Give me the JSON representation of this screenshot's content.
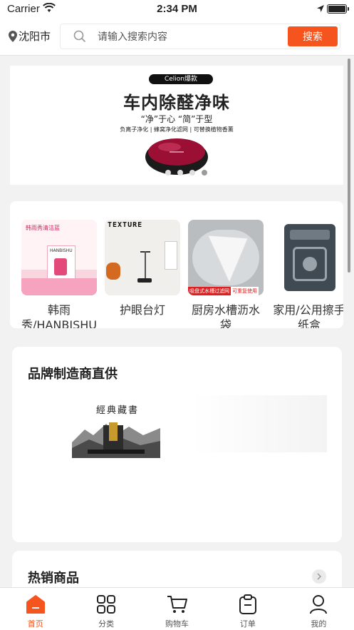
{
  "status_bar": {
    "carrier": "Carrier",
    "time": "2:34 PM"
  },
  "header": {
    "city": "沈阳市",
    "search_placeholder": "请输入搜索内容",
    "search_button": "搜索"
  },
  "banner": {
    "badge": "Celion爆款",
    "headline": "车内除醛净味",
    "slogan": "“净”于心  “简”于型",
    "features": "负离子净化 | 蜂窝净化滤网 | 可替换植物香薰",
    "slide_count": 4,
    "active_slide": 4
  },
  "categories": [
    {
      "label": "韩雨秀/HANBISHU除",
      "image_text": [
        "韩雨秀清洁蓝",
        "HANBISHU"
      ]
    },
    {
      "label": "护眼台灯",
      "image_text": [
        "TEXTURE"
      ]
    },
    {
      "label": "厨房水槽沥水袋",
      "image_text": [
        "吸盘式水槽过滤网",
        "可重复使用"
      ]
    },
    {
      "label": "家用/公用擦手纸盒",
      "image_text": []
    }
  ],
  "brand_section": {
    "title": "品牌制造商直供",
    "image_text": "經典藏書"
  },
  "hot_section": {
    "title": "热销商品"
  },
  "tabs": [
    {
      "label": "首页",
      "icon": "home-icon",
      "active": true
    },
    {
      "label": "分类",
      "icon": "category-grid-icon",
      "active": false
    },
    {
      "label": "购物车",
      "icon": "cart-icon",
      "active": false
    },
    {
      "label": "订单",
      "icon": "order-clipboard-icon",
      "active": false
    },
    {
      "label": "我的",
      "icon": "profile-icon",
      "active": false
    }
  ],
  "colors": {
    "accent": "#f6541e",
    "background": "#f2f2f2"
  }
}
